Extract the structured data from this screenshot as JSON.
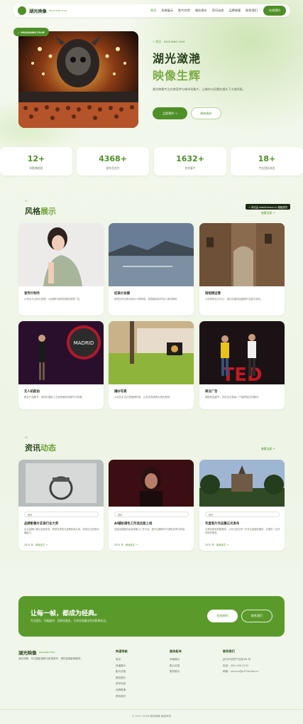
{
  "nav": {
    "brand": "湖光映像",
    "brand_sub": "HUGUANG FILM",
    "items": [
      "首页",
      "风格展示",
      "影片欣赏",
      "服务报价",
      "资讯动态",
      "品牌故事",
      "联系我们"
    ],
    "cta": "在线预约"
  },
  "hero": {
    "tag": "✓ HUGUANG FILM",
    "subtitle": "✓ 武汉 · HUGUANG FILM",
    "title_line1": "湖光潋滟",
    "title_line2": "映像生辉",
    "desc": "湖光映像专注文旅宣传与城市形象片，让城市与风景在镜头下大放异彩。",
    "btn_primary": "立即预约 →",
    "btn_secondary": "服务报价"
  },
  "stats": [
    {
      "num": "12+",
      "label": "年影像经验"
    },
    {
      "num": "4368+",
      "label": "部作品交付"
    },
    {
      "num": "1632+",
      "label": "合作客户"
    },
    {
      "num": "18+",
      "label": "专业团队成员"
    }
  ],
  "styles": {
    "no": "01",
    "title_a": "风格",
    "title_b": "展示",
    "more": "查看全部 →",
    "watermark": "↗ 本站由 web4theme.cn 模板提供",
    "cards": [
      {
        "title": "宣传片制作",
        "desc": "以专业与当地头资源，为品牌打造有质感的视觉广告。"
      },
      {
        "title": "纪录片拍摄",
        "desc": "用镜头的记录手段与人物情感，呈现最真实的动人事件瞬间。"
      },
      {
        "title": "短视频运营",
        "desc": "以你的粉丝为中心，用社交媒体运营提升流量与转化。"
      },
      {
        "title": "无人机航拍",
        "desc": "整合产品细节，用商业摄影工艺呈现最好的细节与效果。"
      },
      {
        "title": "婚纱写真",
        "desc": "以纪实手法记录爱情时刻，让真实的感情为镜头服务。"
      },
      {
        "title": "商业广告",
        "desc": "捕捉商品细节，多机位记录每一个值得铭记的瞬间。"
      }
    ]
  },
  "news": {
    "no": "02",
    "title_a": "资讯",
    "title_b": "动态",
    "more": "查看全部 →",
    "items": [
      {
        "badge": "资讯",
        "title": "品牌影像片实录行业大奖",
        "desc": "企业品牌片展示全国评选，荣获优秀奖与品牌影像大奖，体现企业影像传播能力。",
        "date": "2024 年",
        "link": "阅读全文 →"
      },
      {
        "badge": "资讯",
        "title": "AI辅助调色工作流全面上线",
        "desc": "全面运用摄影高端设备与工作平台，提升后期制作与调色效率与质量。",
        "date": "2024 年",
        "link": "阅读全文 →"
      },
      {
        "badge": "资讯",
        "title": "年度客片作品集正式发布",
        "desc": "为满足更高质客需求，公司引进业界一代专业级摄影器材，并提供一站式的制作服务。",
        "date": "2022 年",
        "link": "阅读全文 →"
      }
    ]
  },
  "cta": {
    "title": "让每一帧，都成为经典。",
    "subtitle": "专业团队 · 顶级器材 · 定制化服务，为你呈现最出色的影像作品。",
    "btn_primary": "在线预约",
    "btn_secondary": "联系我们"
  },
  "footer": {
    "brand": "湖光映像",
    "brand_sub": "HUGUANG FILM",
    "desc": "湖光映像，专注摄影摄像与影视制作，提供高端影像服务。",
    "col1_title": "快速导航",
    "col1": [
      "首页",
      "风格展示",
      "影片欣赏",
      "服务报价",
      "资讯动态",
      "品牌故事",
      "联系我们"
    ],
    "col2_title": "服务板块",
    "col2": [
      "风格展示",
      "影片欣赏",
      "服务报价"
    ],
    "col3_title": "联系我们",
    "col3": [
      "武汉市创意产业园 88 号",
      "电话：400-136-2132",
      "邮箱：service@p57studio.cn"
    ],
    "copyright": "© 2017-2026 湖光映像 版权所有"
  }
}
